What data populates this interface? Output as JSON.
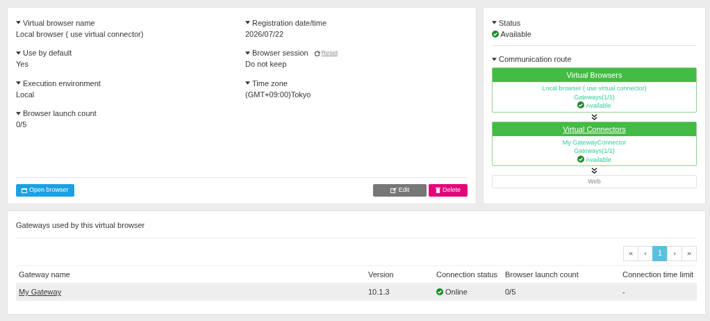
{
  "details": {
    "left": [
      {
        "label": "Virtual browser name",
        "value": "Local browser ( use virtual connector)"
      },
      {
        "label": "Use by default",
        "value": "Yes"
      },
      {
        "label": "Execution environment",
        "value": "Local"
      },
      {
        "label": "Browser launch count",
        "value": "0/5"
      }
    ],
    "right": [
      {
        "label": "Registration date/time",
        "value": "2026/07/22"
      },
      {
        "label": "Browser session",
        "value": "Do not keep",
        "link": "Reset"
      },
      {
        "label": "Time zone",
        "value": "(GMT+09:00)Tokyo"
      }
    ],
    "buttons": [
      {
        "kind": "open",
        "label": "Open browser"
      },
      {
        "kind": "edit",
        "label": "Edit"
      },
      {
        "kind": "delete",
        "label": "Delete"
      }
    ]
  },
  "status": {
    "label": "Status",
    "value": "Available"
  },
  "route": {
    "label": "Communication route",
    "nodes": [
      {
        "title": "Virtual Browsers",
        "link": false,
        "lines": [
          "Local browser ( use virtual connector)",
          "Gateways(1/1)"
        ],
        "status": "Available"
      },
      {
        "title": "Virtual Connectors",
        "link": true,
        "lines": [
          "My GatewayConnector",
          "Gateways(1/1)"
        ],
        "status": "Available"
      }
    ],
    "end": "Web"
  },
  "gateways": {
    "title": "Gateways used by this virtual browser",
    "pagination": [
      {
        "label": "«",
        "selected": false
      },
      {
        "label": "‹",
        "selected": false
      },
      {
        "label": "1",
        "selected": true
      },
      {
        "label": "›",
        "selected": false
      },
      {
        "label": "»",
        "selected": false
      }
    ],
    "columns": [
      "Gateway name",
      "Version",
      "Connection status",
      "Browser launch count",
      "Connection time limit"
    ],
    "rows": [
      {
        "name": "My Gateway",
        "version": "10.1.3",
        "status": "Online",
        "count": "0/5",
        "limit": "-"
      }
    ]
  }
}
